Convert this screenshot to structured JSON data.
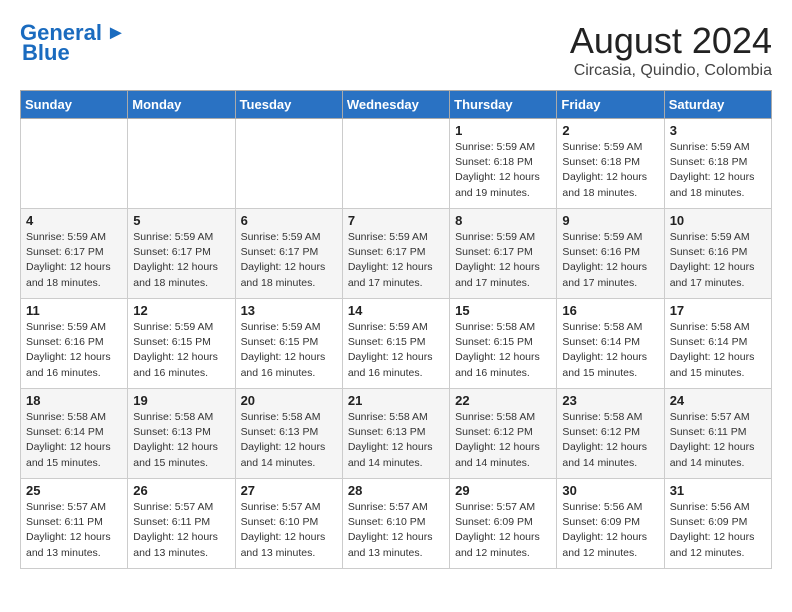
{
  "header": {
    "logo_line1": "General",
    "logo_line2": "Blue",
    "month_year": "August 2024",
    "location": "Circasia, Quindio, Colombia"
  },
  "weekdays": [
    "Sunday",
    "Monday",
    "Tuesday",
    "Wednesday",
    "Thursday",
    "Friday",
    "Saturday"
  ],
  "weeks": [
    [
      {
        "day": "",
        "info": ""
      },
      {
        "day": "",
        "info": ""
      },
      {
        "day": "",
        "info": ""
      },
      {
        "day": "",
        "info": ""
      },
      {
        "day": "1",
        "info": "Sunrise: 5:59 AM\nSunset: 6:18 PM\nDaylight: 12 hours\nand 19 minutes."
      },
      {
        "day": "2",
        "info": "Sunrise: 5:59 AM\nSunset: 6:18 PM\nDaylight: 12 hours\nand 18 minutes."
      },
      {
        "day": "3",
        "info": "Sunrise: 5:59 AM\nSunset: 6:18 PM\nDaylight: 12 hours\nand 18 minutes."
      }
    ],
    [
      {
        "day": "4",
        "info": "Sunrise: 5:59 AM\nSunset: 6:17 PM\nDaylight: 12 hours\nand 18 minutes."
      },
      {
        "day": "5",
        "info": "Sunrise: 5:59 AM\nSunset: 6:17 PM\nDaylight: 12 hours\nand 18 minutes."
      },
      {
        "day": "6",
        "info": "Sunrise: 5:59 AM\nSunset: 6:17 PM\nDaylight: 12 hours\nand 18 minutes."
      },
      {
        "day": "7",
        "info": "Sunrise: 5:59 AM\nSunset: 6:17 PM\nDaylight: 12 hours\nand 17 minutes."
      },
      {
        "day": "8",
        "info": "Sunrise: 5:59 AM\nSunset: 6:17 PM\nDaylight: 12 hours\nand 17 minutes."
      },
      {
        "day": "9",
        "info": "Sunrise: 5:59 AM\nSunset: 6:16 PM\nDaylight: 12 hours\nand 17 minutes."
      },
      {
        "day": "10",
        "info": "Sunrise: 5:59 AM\nSunset: 6:16 PM\nDaylight: 12 hours\nand 17 minutes."
      }
    ],
    [
      {
        "day": "11",
        "info": "Sunrise: 5:59 AM\nSunset: 6:16 PM\nDaylight: 12 hours\nand 16 minutes."
      },
      {
        "day": "12",
        "info": "Sunrise: 5:59 AM\nSunset: 6:15 PM\nDaylight: 12 hours\nand 16 minutes."
      },
      {
        "day": "13",
        "info": "Sunrise: 5:59 AM\nSunset: 6:15 PM\nDaylight: 12 hours\nand 16 minutes."
      },
      {
        "day": "14",
        "info": "Sunrise: 5:59 AM\nSunset: 6:15 PM\nDaylight: 12 hours\nand 16 minutes."
      },
      {
        "day": "15",
        "info": "Sunrise: 5:58 AM\nSunset: 6:15 PM\nDaylight: 12 hours\nand 16 minutes."
      },
      {
        "day": "16",
        "info": "Sunrise: 5:58 AM\nSunset: 6:14 PM\nDaylight: 12 hours\nand 15 minutes."
      },
      {
        "day": "17",
        "info": "Sunrise: 5:58 AM\nSunset: 6:14 PM\nDaylight: 12 hours\nand 15 minutes."
      }
    ],
    [
      {
        "day": "18",
        "info": "Sunrise: 5:58 AM\nSunset: 6:14 PM\nDaylight: 12 hours\nand 15 minutes."
      },
      {
        "day": "19",
        "info": "Sunrise: 5:58 AM\nSunset: 6:13 PM\nDaylight: 12 hours\nand 15 minutes."
      },
      {
        "day": "20",
        "info": "Sunrise: 5:58 AM\nSunset: 6:13 PM\nDaylight: 12 hours\nand 14 minutes."
      },
      {
        "day": "21",
        "info": "Sunrise: 5:58 AM\nSunset: 6:13 PM\nDaylight: 12 hours\nand 14 minutes."
      },
      {
        "day": "22",
        "info": "Sunrise: 5:58 AM\nSunset: 6:12 PM\nDaylight: 12 hours\nand 14 minutes."
      },
      {
        "day": "23",
        "info": "Sunrise: 5:58 AM\nSunset: 6:12 PM\nDaylight: 12 hours\nand 14 minutes."
      },
      {
        "day": "24",
        "info": "Sunrise: 5:57 AM\nSunset: 6:11 PM\nDaylight: 12 hours\nand 14 minutes."
      }
    ],
    [
      {
        "day": "25",
        "info": "Sunrise: 5:57 AM\nSunset: 6:11 PM\nDaylight: 12 hours\nand 13 minutes."
      },
      {
        "day": "26",
        "info": "Sunrise: 5:57 AM\nSunset: 6:11 PM\nDaylight: 12 hours\nand 13 minutes."
      },
      {
        "day": "27",
        "info": "Sunrise: 5:57 AM\nSunset: 6:10 PM\nDaylight: 12 hours\nand 13 minutes."
      },
      {
        "day": "28",
        "info": "Sunrise: 5:57 AM\nSunset: 6:10 PM\nDaylight: 12 hours\nand 13 minutes."
      },
      {
        "day": "29",
        "info": "Sunrise: 5:57 AM\nSunset: 6:09 PM\nDaylight: 12 hours\nand 12 minutes."
      },
      {
        "day": "30",
        "info": "Sunrise: 5:56 AM\nSunset: 6:09 PM\nDaylight: 12 hours\nand 12 minutes."
      },
      {
        "day": "31",
        "info": "Sunrise: 5:56 AM\nSunset: 6:09 PM\nDaylight: 12 hours\nand 12 minutes."
      }
    ]
  ]
}
